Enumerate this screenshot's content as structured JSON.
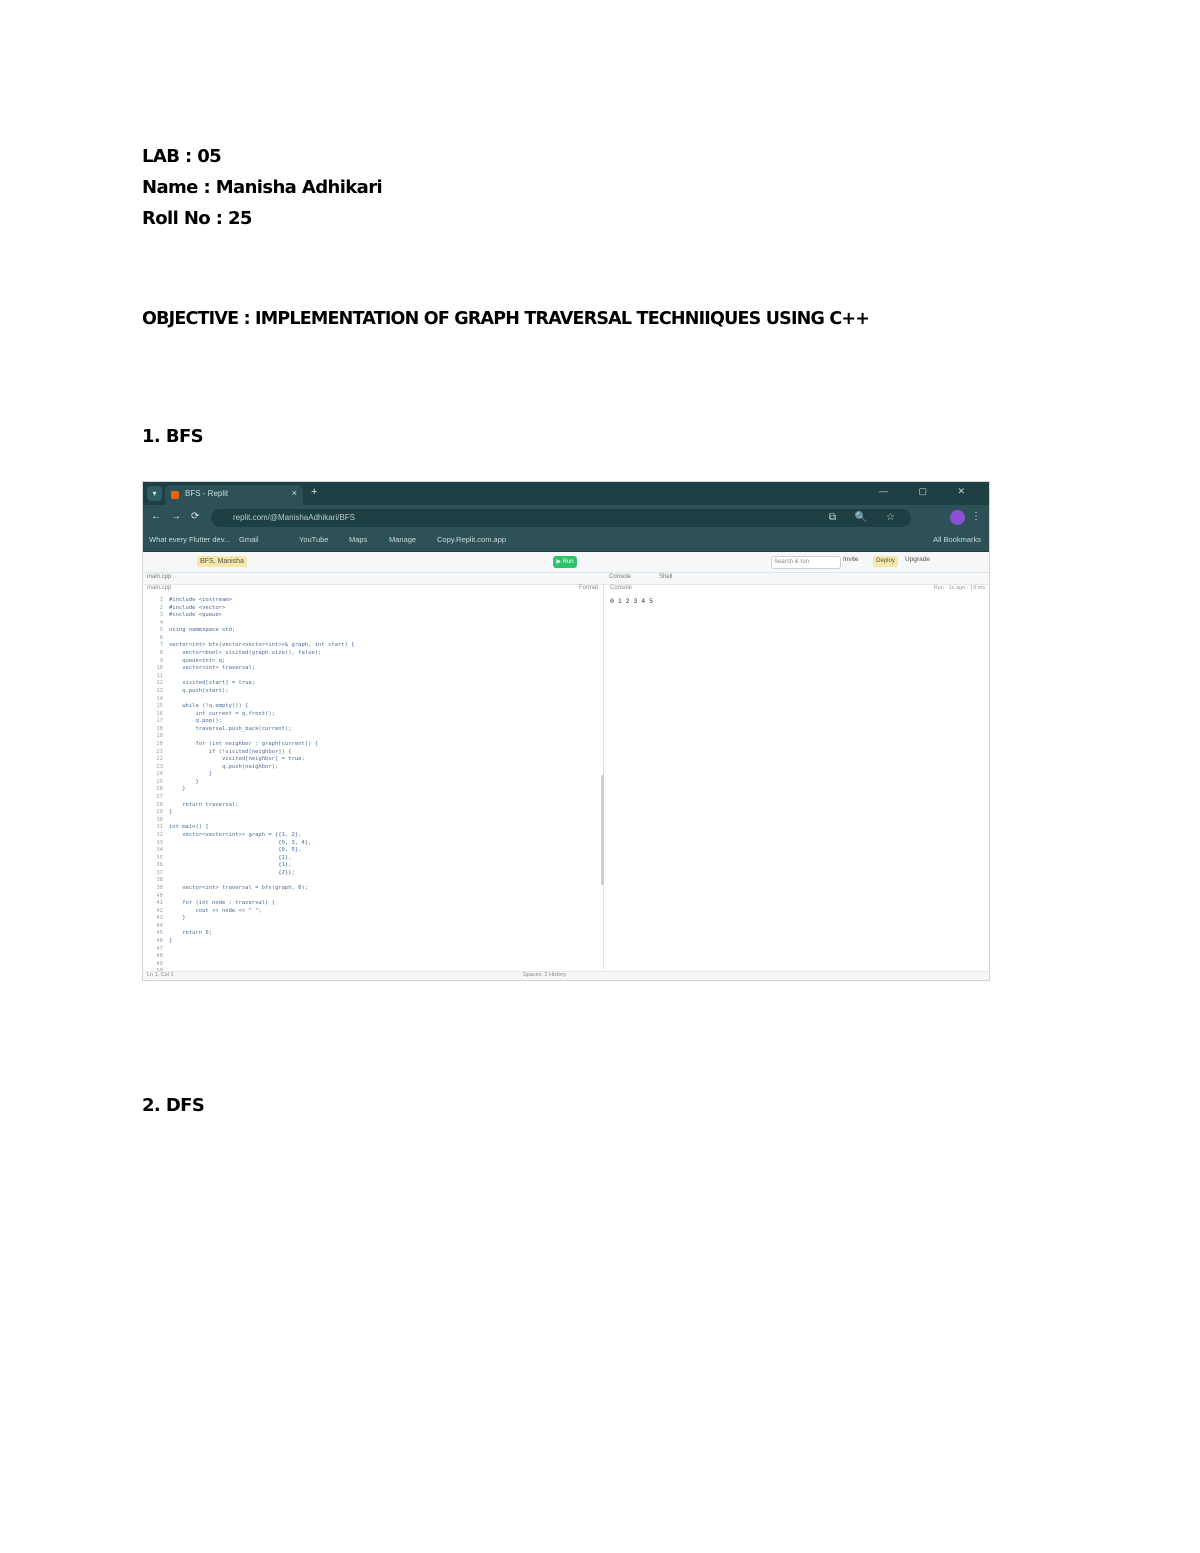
{
  "document": {
    "lab": "LAB : 05",
    "name": "Name : Manisha Adhikari",
    "roll": "Roll  No : 25",
    "objective": "OBJECTIVE : IMPLEMENTATION OF GRAPH TRAVERSAL TECHNIIQUES USING  C++",
    "section1": "1. BFS",
    "section2": "2.  DFS"
  },
  "screenshot": {
    "tab_title": "BFS - Replit",
    "tab_close": "×",
    "tab_new": "+",
    "window_controls": "—  ▢  ✕",
    "nav_back": "←",
    "nav_forward": "→",
    "nav_reload": "⟳",
    "url": "replit.com/@ManishaAdhikari/BFS",
    "omnibox_icons": "⧉ 🔍 ☆",
    "menu_dots": "⋮",
    "bookmarks": [
      "What every Flutter dev...",
      "Gmail",
      "YouTube",
      "Maps",
      "Manage",
      "Copy.Replit.com.app"
    ],
    "all_bookmarks": "All Bookmarks",
    "repl_name": "BFS, Manisha",
    "run_label": "▶ Run",
    "search_placeholder": "Search & run commands",
    "invite_label": "Invite",
    "deploy_label": "Deploy",
    "upgrade_label": "Upgrade",
    "editor_tab": "main.cpp",
    "console_tab": "Console",
    "shell_tab": "Shell",
    "breadcrumb": "main.cpp",
    "format_label": "Format",
    "line_numbers": "1\n2\n3\n4\n5\n6\n7\n8\n9\n10\n11\n12\n13\n14\n15\n16\n17\n18\n19\n20\n21\n22\n23\n24\n25\n26\n27\n28\n29\n30\n31\n32\n33\n34\n35\n36\n37\n38\n39\n40\n41\n42\n43\n44\n45\n46\n47\n48\n49\n50",
    "code": "#include <iostream>\n#include <vector>\n#include <queue>\n\nusing namespace std;\n\nvector<int> bfs(vector<vector<int>>& graph, int start) {\n    vector<bool> visited(graph.size(), false);\n    queue<int> q;\n    vector<int> traversal;\n\n    visited[start] = true;\n    q.push(start);\n\n    while (!q.empty()) {\n        int current = q.front();\n        q.pop();\n        traversal.push_back(current);\n\n        for (int neighbor : graph[current]) {\n            if (!visited[neighbor]) {\n                visited[neighbor] = true;\n                q.push(neighbor);\n            }\n        }\n    }\n\n    return traversal;\n}\n\nint main() {\n    vector<vector<int>> graph = {{1, 2},\n                                 {0, 3, 4},\n                                 {0, 5},\n                                 {1},\n                                 {1},\n                                 {2}};\n\n    vector<int> traversal = bfs(graph, 0);\n\n    for (int node : traversal) {\n        cout << node << \" \";\n    }\n\n    return 0;\n}",
    "console_output": "0 1 2 3 4 5",
    "console_meta": "Run · 1s ago · 19 ms",
    "status_left": "Ln 1, Col 1",
    "status_right": "Spaces: 2  History"
  },
  "colors": {
    "browser_dark": "#1e3f44",
    "browser_mid": "#2c5258",
    "run_green": "#2ec36b",
    "code_blue": "#4a6b9a"
  }
}
